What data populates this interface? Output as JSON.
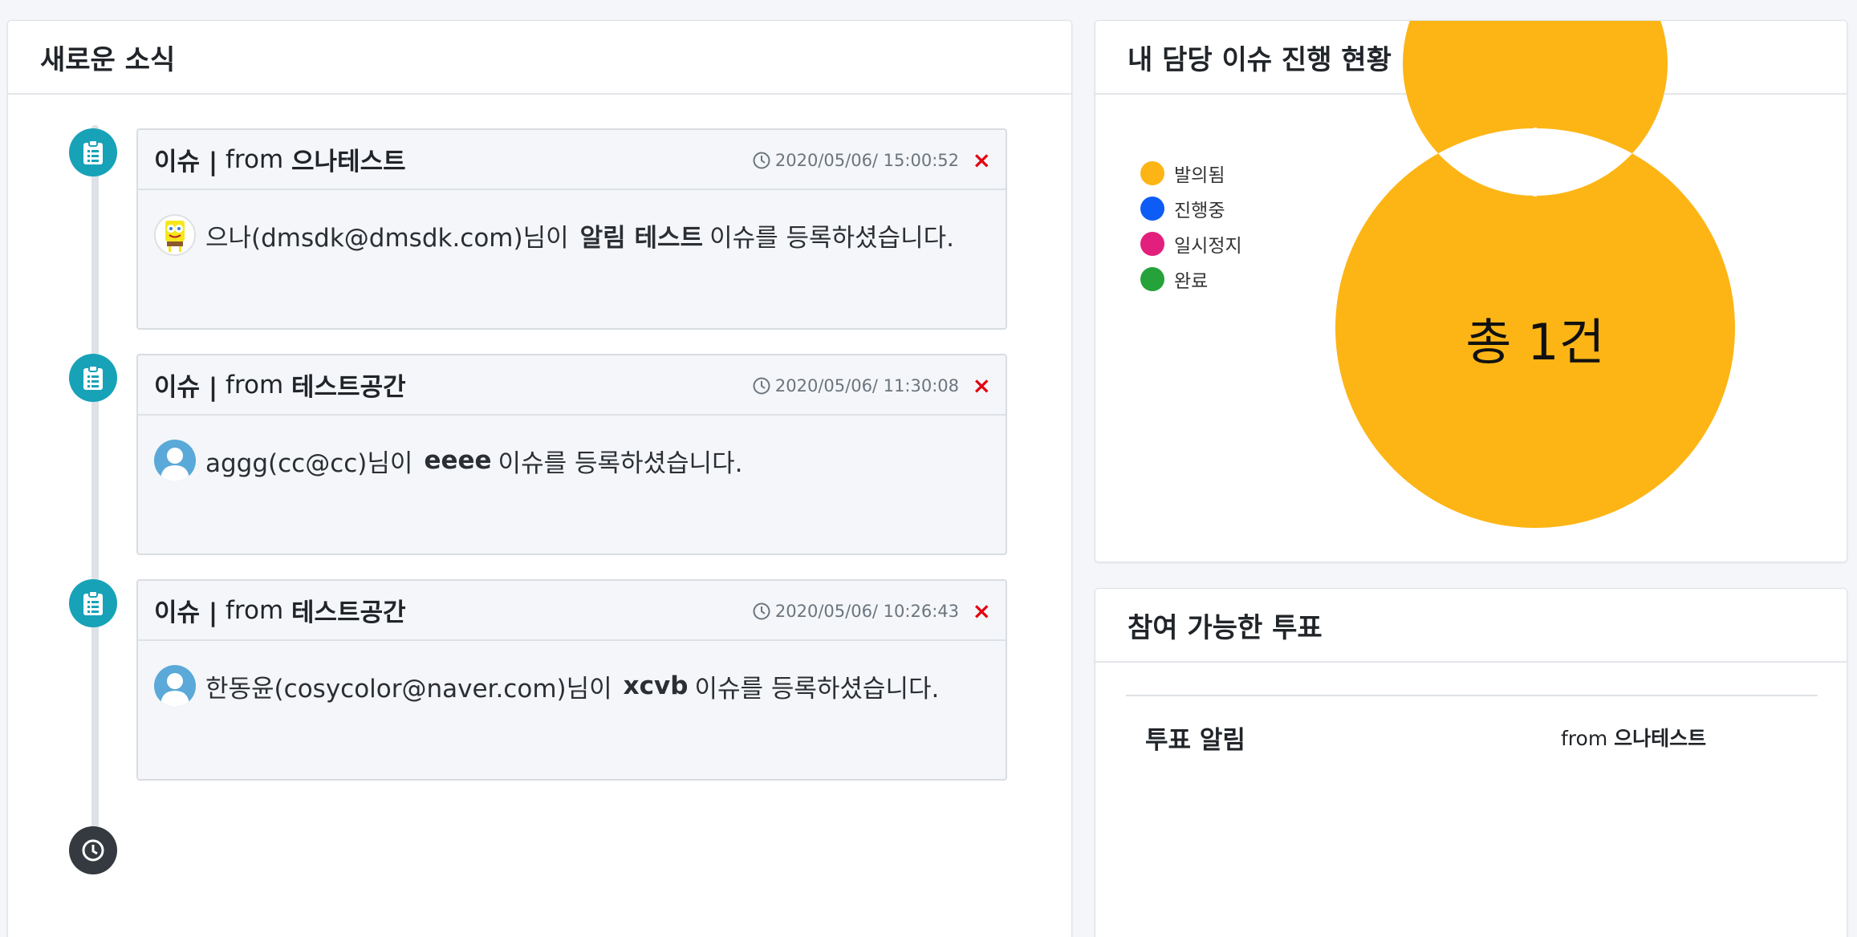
{
  "news": {
    "title": "새로운 소식",
    "items": [
      {
        "type_label": "이슈 |",
        "from_word": "from",
        "source": "으나테스트",
        "time": "2020/05/06/ 15:00:52",
        "close": "×",
        "avatar": "spongebob-avatar",
        "user": "으나(dmsdk@dmsdk.com)님이",
        "issue": "알림 테스트",
        "suffix": "이슈를 등록하셨습니다."
      },
      {
        "type_label": "이슈 |",
        "from_word": "from",
        "source": "테스트공간",
        "time": "2020/05/06/ 11:30:08",
        "close": "×",
        "avatar": "default-avatar",
        "user": "aggg(cc@cc)님이",
        "issue": "eeee",
        "suffix": "이슈를 등록하셨습니다."
      },
      {
        "type_label": "이슈 |",
        "from_word": "from",
        "source": "테스트공간",
        "time": "2020/05/06/ 10:26:43",
        "close": "×",
        "avatar": "default-avatar",
        "user": "한동윤(cosycolor@naver.com)님이",
        "issue": "xcvb",
        "suffix": "이슈를 등록하셨습니다."
      }
    ]
  },
  "status": {
    "title": "내 담당 이슈 진행 현황",
    "center_label": "총 1건",
    "legend": [
      {
        "label": "발의됨",
        "color": "#fdb515"
      },
      {
        "label": "진행중",
        "color": "#0d5cf5"
      },
      {
        "label": "일시정지",
        "color": "#e31f7d"
      },
      {
        "label": "완료",
        "color": "#26a23b"
      }
    ]
  },
  "chart_data": {
    "type": "pie",
    "style": "doughnut",
    "categories": [
      "발의됨",
      "진행중",
      "일시정지",
      "완료"
    ],
    "values": [
      1,
      0,
      0,
      0
    ],
    "colors": [
      "#fdb515",
      "#0d5cf5",
      "#e31f7d",
      "#26a23b"
    ],
    "center_text": "총 1건",
    "legend_position": "top-left"
  },
  "vote": {
    "title": "참여 가능한 투표",
    "items": [
      {
        "title": "투표 알림",
        "from_word": "from",
        "source": "으나테스트"
      }
    ]
  }
}
